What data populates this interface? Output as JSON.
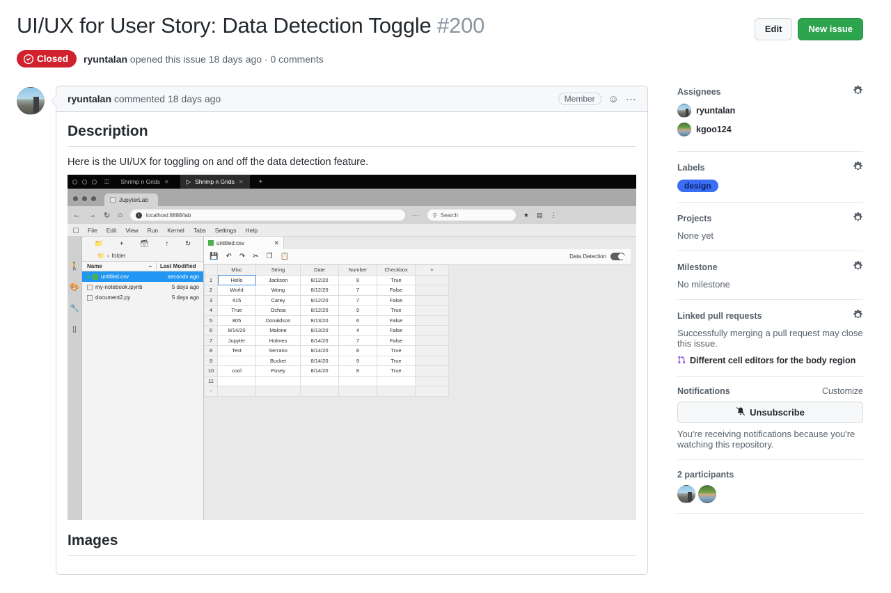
{
  "header": {
    "title": "UI/UX for User Story: Data Detection Toggle",
    "number": "#200",
    "edit_label": "Edit",
    "new_issue_label": "New issue",
    "state": "Closed",
    "meta_author": "ryuntalan",
    "meta_rest": " opened this issue 18 days ago · 0 comments"
  },
  "comment": {
    "author": "ryuntalan",
    "action": "commented 18 days ago",
    "badge": "Member",
    "emoji_icon": "☺",
    "kebab_icon": "···",
    "heading": "Description",
    "paragraph": "Here is the UI/UX for toggling on and off the data detection feature.",
    "heading2": "Images"
  },
  "screenshot": {
    "os_tabs": [
      {
        "label": "Shrimp n Grids",
        "active": false
      },
      {
        "label": "Shrimp n Grids",
        "active": true
      }
    ],
    "browser_tab": "JupyterLab",
    "url": "localhost:8888/lab",
    "search_placeholder": "Search",
    "menu": [
      "File",
      "Edit",
      "View",
      "Run",
      "Kernel",
      "Tabs",
      "Settings",
      "Help"
    ],
    "breadcrumb": "folder",
    "file_columns": {
      "name": "Name",
      "modified": "Last Modified"
    },
    "files": [
      {
        "name": "untitled.csv",
        "modified": "seconds ago",
        "selected": true
      },
      {
        "name": "my-notebook.ipynb",
        "modified": "5 days ago",
        "selected": false
      },
      {
        "name": "document2.py",
        "modified": "5 days ago",
        "selected": false
      }
    ],
    "doc_tab": "untitled.csv",
    "data_detection_label": "Data Detection",
    "table": {
      "columns": [
        "",
        "Misc",
        "String",
        "Date",
        "Number",
        "Checkbox",
        "+"
      ],
      "rows": [
        [
          "1",
          "Hello",
          "Jackson",
          "8/12/20",
          "8",
          "True"
        ],
        [
          "2",
          "World",
          "Wong",
          "8/12/20",
          "7",
          "False"
        ],
        [
          "3",
          "415",
          "Carey",
          "8/12/20",
          "7",
          "False"
        ],
        [
          "4",
          "True",
          "Ochoa",
          "8/12/20",
          "9",
          "True"
        ],
        [
          "5",
          "805",
          "Donaldson",
          "8/13/20",
          "6",
          "False"
        ],
        [
          "6",
          "8/14/20",
          "Malone",
          "8/13/20",
          "4",
          "False"
        ],
        [
          "7",
          "Jupyter",
          "Holmes",
          "8/14/20",
          "7",
          "False"
        ],
        [
          "8",
          "Test",
          "Serrano",
          "8/14/20",
          "8",
          "True"
        ],
        [
          "9",
          "",
          "Bucket",
          "8/14/20",
          "9",
          "True"
        ],
        [
          "10",
          "cool",
          "Posey",
          "8/14/20",
          "8",
          "True"
        ],
        [
          "11",
          "",
          "",
          "",
          "",
          ""
        ]
      ]
    }
  },
  "sidebar": {
    "assignees": {
      "title": "Assignees",
      "people": [
        "ryuntalan",
        "kgoo124"
      ]
    },
    "labels": {
      "title": "Labels",
      "items": [
        "design"
      ]
    },
    "projects": {
      "title": "Projects",
      "value": "None yet"
    },
    "milestone": {
      "title": "Milestone",
      "value": "No milestone"
    },
    "linked_prs": {
      "title": "Linked pull requests",
      "description": "Successfully merging a pull request may close this issue.",
      "item": "Different cell editors for the body region"
    },
    "notifications": {
      "title": "Notifications",
      "customize": "Customize",
      "unsubscribe": "Unsubscribe",
      "note": "You're receiving notifications because you're watching this repository."
    },
    "participants": {
      "title": "2 participants"
    }
  },
  "colors": {
    "closed_red": "#cf222e",
    "green_button": "#2da44e",
    "label_blue": "#3b6ef5",
    "pr_purple": "#8250df"
  }
}
